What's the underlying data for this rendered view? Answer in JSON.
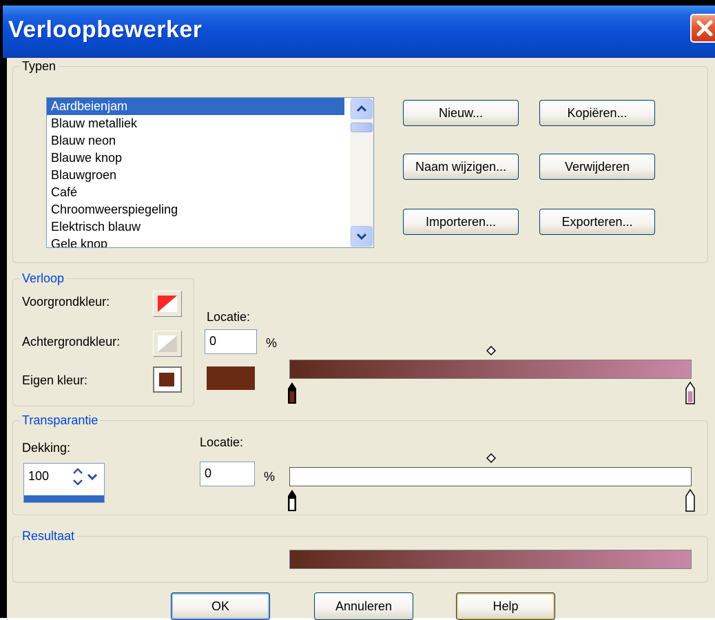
{
  "window": {
    "title": "Verloopbewerker"
  },
  "typen": {
    "group_label": "Typen",
    "items": [
      "Aardbeienjam",
      "Blauw metalliek",
      "Blauw neon",
      "Blauwe knop",
      "Blauwgroen",
      "Café",
      "Chroomweerspiegeling",
      "Elektrisch blauw",
      "Gele knop"
    ],
    "selected": "Aardbeienjam",
    "buttons": {
      "nieuw": "Nieuw...",
      "kopieren": "Kopiëren...",
      "naam_wijzigen": "Naam wijzigen...",
      "verwijderen": "Verwijderen",
      "importeren": "Importeren...",
      "exporteren": "Exporteren..."
    }
  },
  "verloop": {
    "group_label": "Verloop",
    "voorgrond_label": "Voorgrondkleur:",
    "achtergrond_label": "Achtergrondkleur:",
    "eigen_label": "Eigen kleur:",
    "locatie_label": "Locatie:",
    "locatie_value": "0",
    "percent": "%",
    "eigen_color": "#6b2a14",
    "gradient_start": "#5e2a1c",
    "gradient_end": "#c889a8"
  },
  "transparantie": {
    "group_label": "Transparantie",
    "dekking_label": "Dekking:",
    "dekking_value": "100",
    "locatie_label": "Locatie:",
    "locatie_value": "0",
    "percent": "%"
  },
  "resultaat": {
    "group_label": "Resultaat"
  },
  "footer": {
    "ok": "OK",
    "annuleren": "Annuleren",
    "help": "Help"
  }
}
